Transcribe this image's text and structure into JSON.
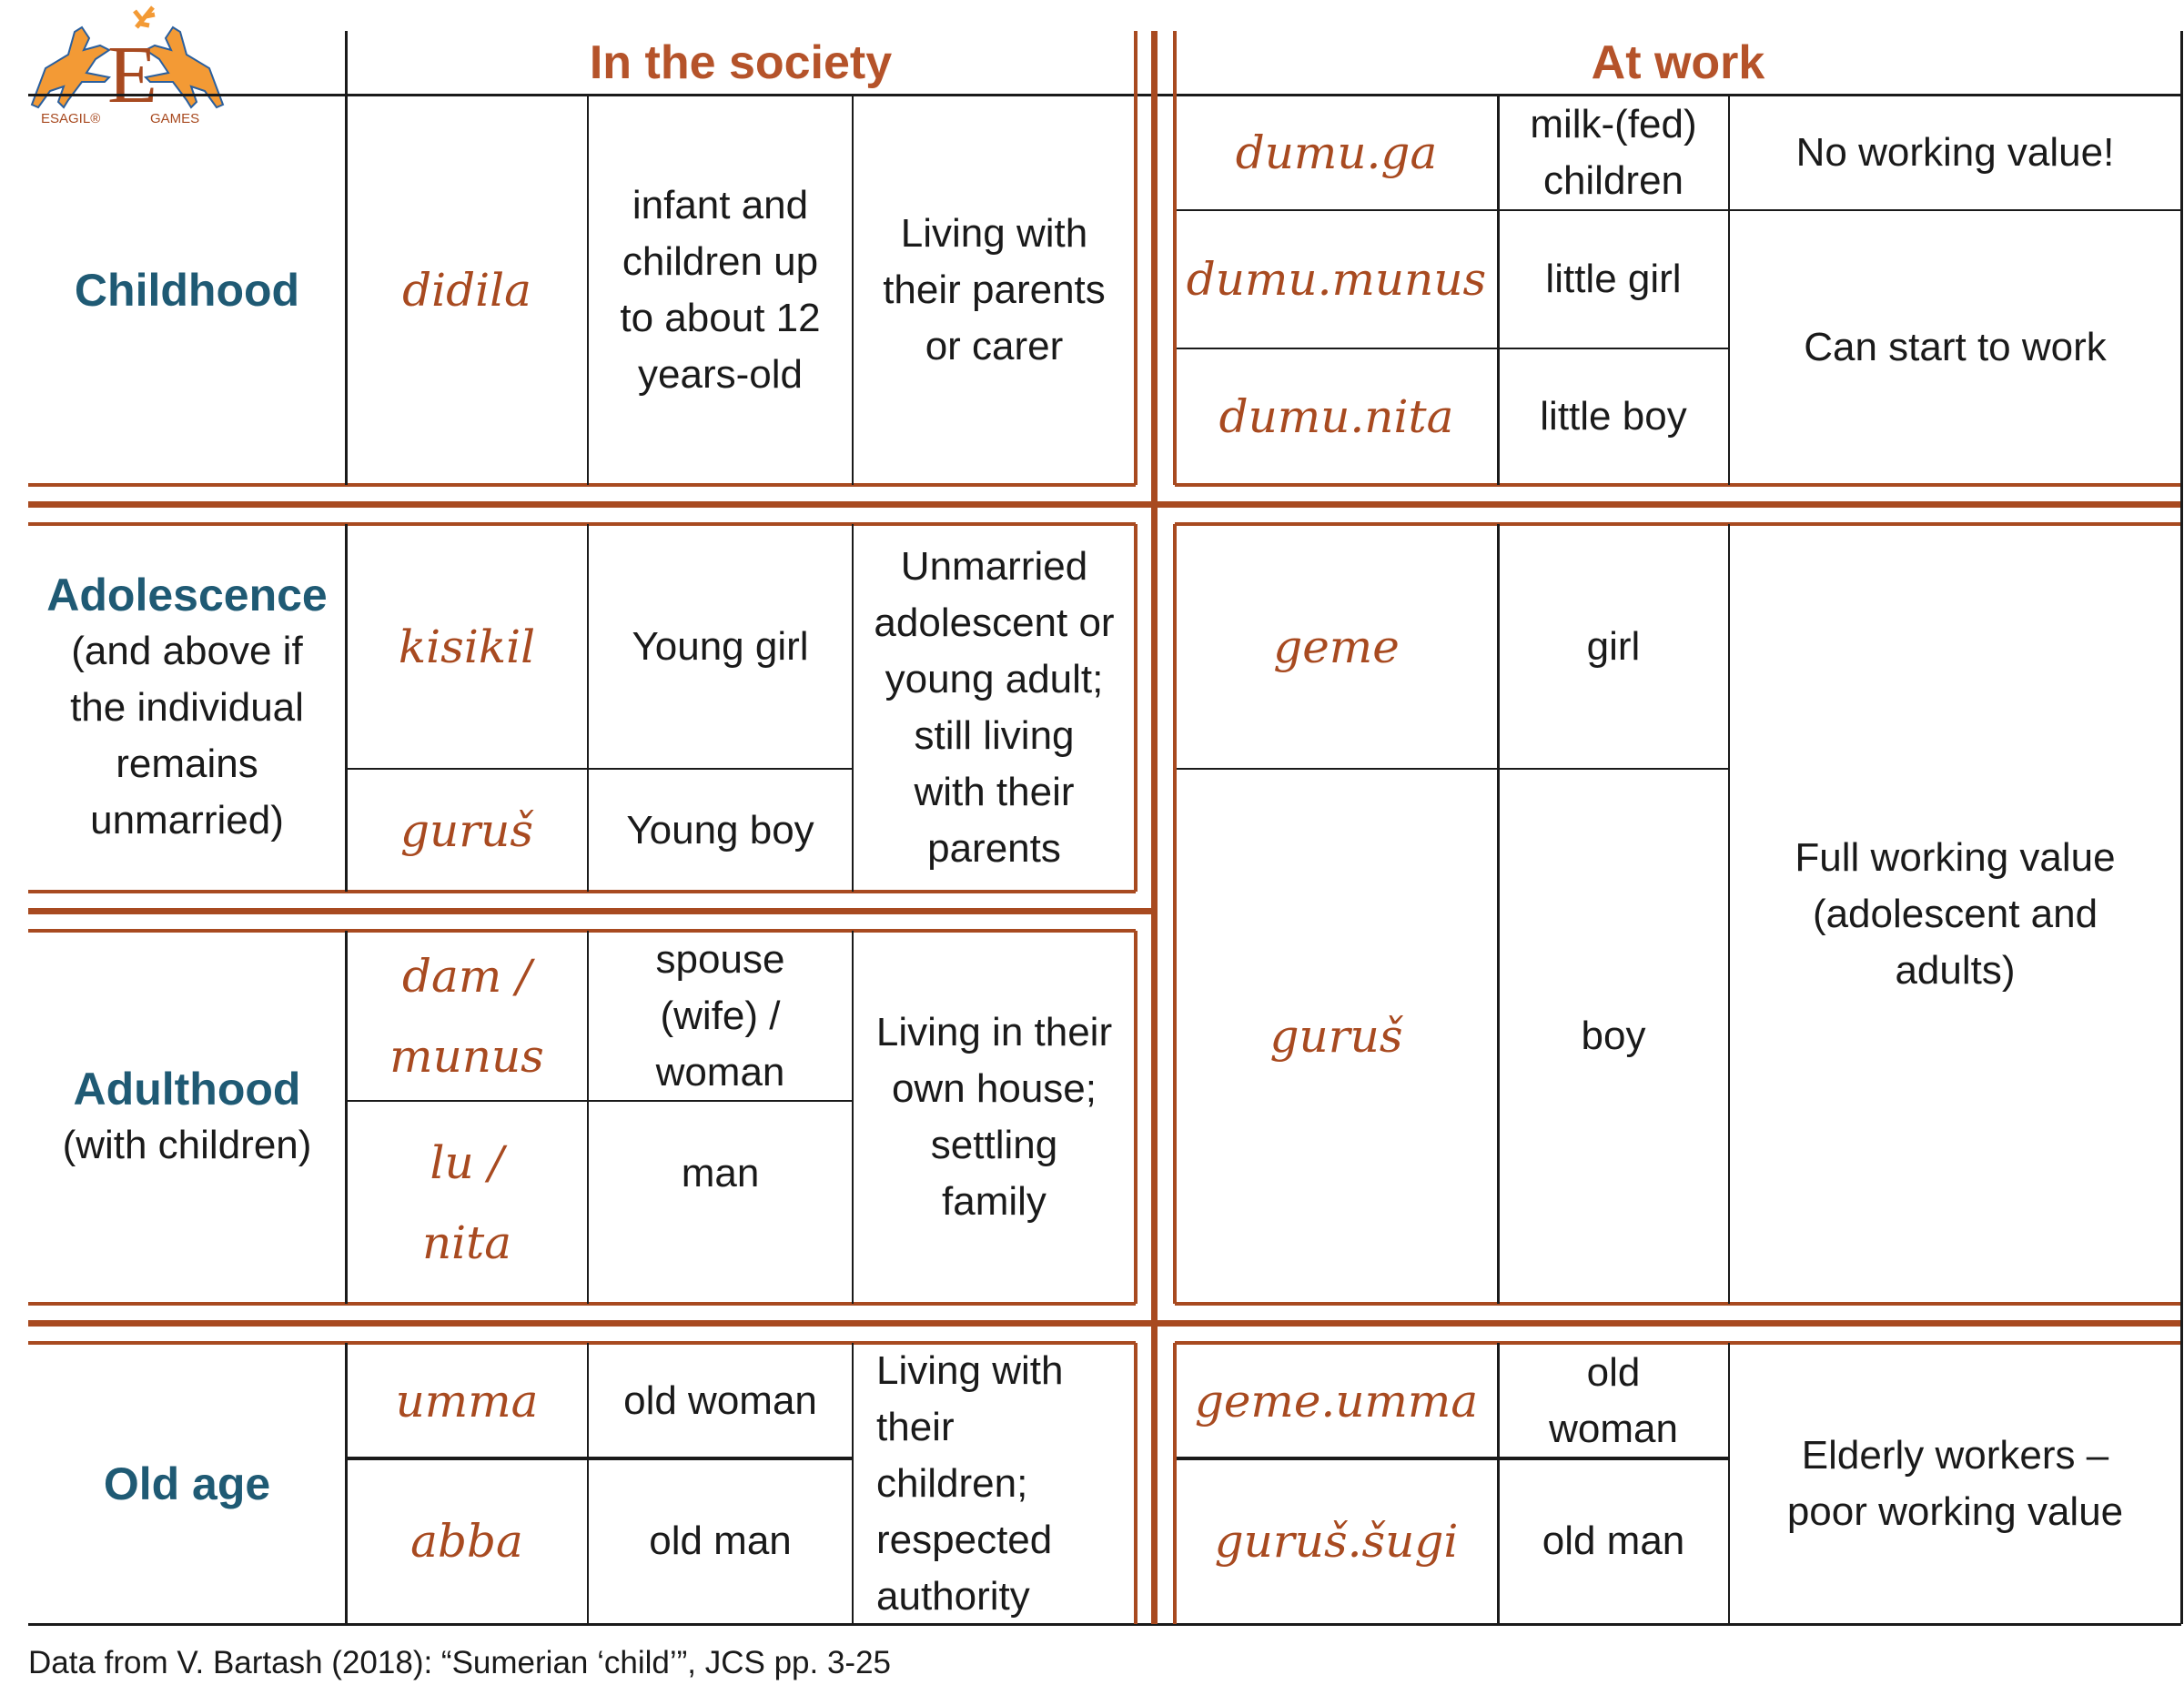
{
  "logo": {
    "left": "ESAGIL",
    "right": "GAMES",
    "letter": "E"
  },
  "headers": {
    "society": "In the society",
    "work": "At work"
  },
  "colors": {
    "brown": "#a84a20",
    "stage_blue": "#1f5a74",
    "header": "#b5532a"
  },
  "childhood": {
    "stage": "Childhood",
    "society": {
      "term": "didila",
      "meaning": "infant and\nchildren up\nto about 12\nyears-old",
      "status": "Living with\ntheir parents\nor carer"
    },
    "work": [
      {
        "term": "dumu.ga",
        "meaning": "milk-(fed)\nchildren"
      },
      {
        "term": "dumu.munus",
        "meaning": "little girl"
      },
      {
        "term": "dumu.nita",
        "meaning": "little boy"
      }
    ],
    "work_value_1": "No working value!",
    "work_value_2": "Can start to work"
  },
  "adolescence": {
    "stage": "Adolescence",
    "stage_note": "(and above if\nthe individual\nremains\nunmarried)",
    "society": [
      {
        "term": "kisikil",
        "meaning": "Young girl"
      },
      {
        "term": "guruš",
        "meaning": "Young boy"
      }
    ],
    "status": "Unmarried\nadolescent or\nyoung adult;\nstill living\nwith their\nparents"
  },
  "adulthood": {
    "stage": "Adulthood",
    "stage_note": "(with children)",
    "society": [
      {
        "term": "dam /\nmunus",
        "meaning": "spouse\n(wife) /\nwoman"
      },
      {
        "term": "lu /\nnita",
        "meaning": "man"
      }
    ],
    "status": "Living in their\nown house;\nsettling\nfamily"
  },
  "adult_work": {
    "rows": [
      {
        "term": "geme",
        "meaning": "girl"
      },
      {
        "term": "guruš",
        "meaning": "boy"
      }
    ],
    "value": "Full working value\n(adolescent and\nadults)"
  },
  "old_age": {
    "stage": "Old age",
    "society": [
      {
        "term": "umma",
        "meaning": "old woman"
      },
      {
        "term": "abba",
        "meaning": "old man"
      }
    ],
    "status": "Living with\ntheir\nchildren;\nrespected\nauthority",
    "work": [
      {
        "term": "geme.umma",
        "meaning": "old\nwoman"
      },
      {
        "term": "guruš.šugi",
        "meaning": "old man"
      }
    ],
    "value": "Elderly workers –\npoor working value"
  },
  "footer": "Data from V. Bartash (2018): “Sumerian ‘child’”, JCS pp. 3-25"
}
